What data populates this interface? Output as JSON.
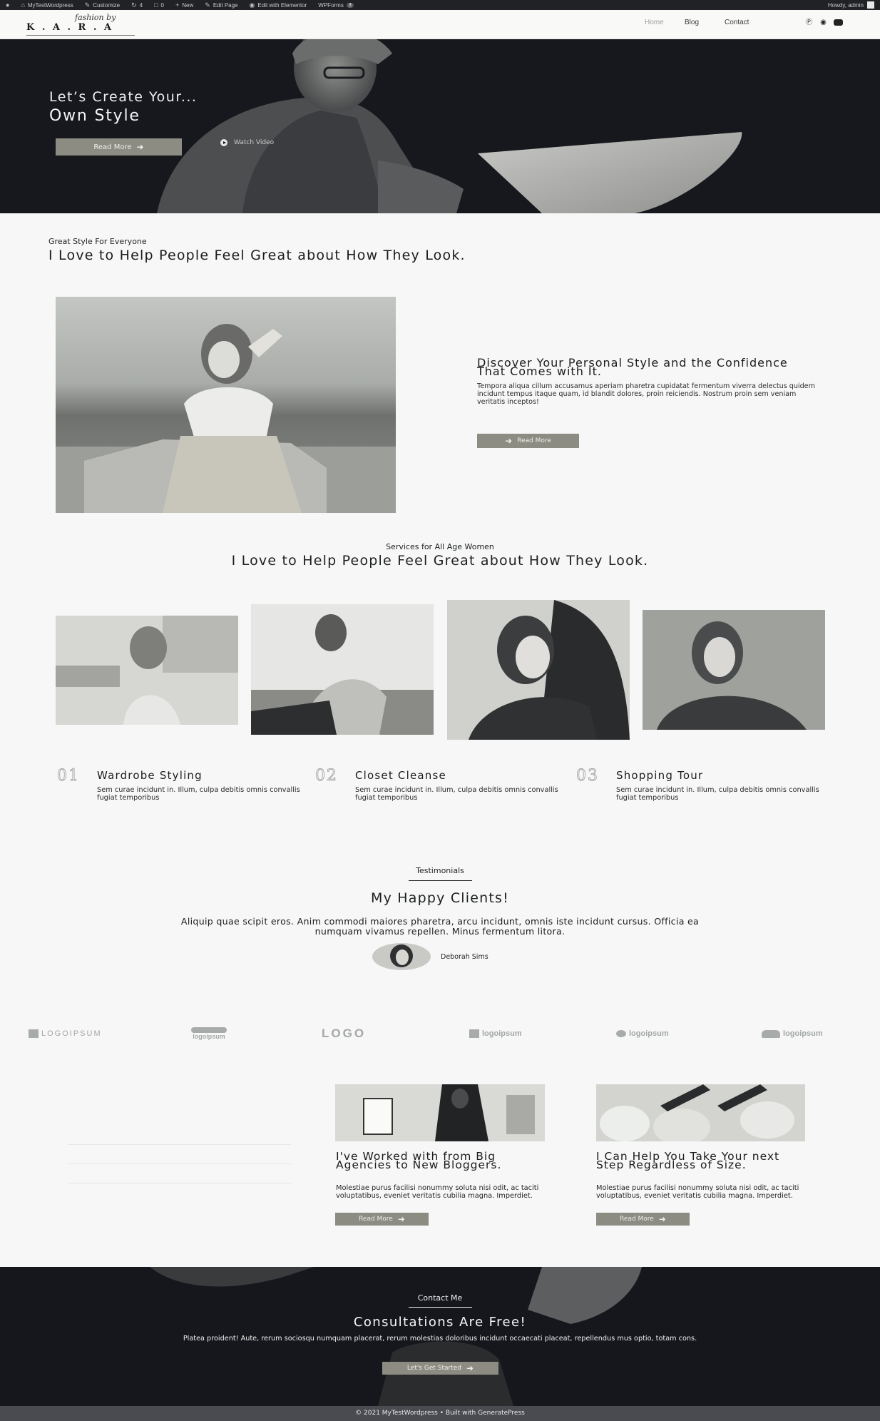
{
  "admin_bar": {
    "site_name": "MyTestWordpress",
    "customize": "Customize",
    "updates_count": "4",
    "comments_count": "0",
    "new": "New",
    "edit_page": "Edit Page",
    "edit_elementor": "Edit with Elementor",
    "wpforms": "WPForms",
    "wpforms_count": "3",
    "howdy": "Howdy, admin"
  },
  "header": {
    "logo_tagline": "fashion by",
    "logo_name": "K . A . R . A",
    "nav": [
      "Home",
      "Blog",
      "Contact"
    ],
    "social_icons": [
      "pinterest-icon",
      "instagram-icon",
      "youtube-icon"
    ]
  },
  "hero": {
    "subtitle": "Let’s Create Your...",
    "title": "Own Style",
    "read_more": "Read More",
    "watch_video": "Watch Video"
  },
  "about": {
    "eyebrow": "Great Style For Everyone",
    "title": "I Love to Help People Feel Great about How They Look.",
    "heading": "Discover Your Personal Style and the Confidence That Comes with It.",
    "text": "Tempora aliqua cillum accusamus aperiam pharetra cupidatat fermentum viverra delectus quidem incidunt tempus itaque quam, id blandit dolores, proin reiciendis. Nostrum proin sem veniam veritatis inceptos!",
    "button": "Read More"
  },
  "services": {
    "eyebrow": "Services for All Age Women",
    "title": "I Love to Help People Feel Great about How They Look.",
    "items": [
      {
        "num": "01",
        "name": "Wardrobe Styling",
        "desc": "Sem curae incidunt in. Illum, culpa debitis omnis convallis fugiat temporibus"
      },
      {
        "num": "02",
        "name": "Closet Cleanse",
        "desc": "Sem curae incidunt in. Illum, culpa debitis omnis convallis fugiat temporibus"
      },
      {
        "num": "03",
        "name": "Shopping Tour",
        "desc": "Sem curae incidunt in. Illum, culpa debitis omnis convallis fugiat temporibus"
      }
    ]
  },
  "testimonials": {
    "eyebrow": "Testimonials",
    "title": "My Happy Clients!",
    "quote": "Aliquip quae scipit eros. Anim commodi maiores pharetra, arcu incidunt, omnis iste incidunt cursus. Officia ea numquam vivamus repellen. Minus fermentum litora.",
    "name": "Deborah Sims"
  },
  "logos": [
    {
      "text": "LOGOIPSUM"
    },
    {
      "text": "logoipsum"
    },
    {
      "text": "LOGO"
    },
    {
      "text": "logoipsum"
    },
    {
      "text": "logoipsum"
    },
    {
      "text": "logoipsum"
    }
  ],
  "posts": [
    {
      "title": "I've Worked with from Big Agencies to New Bloggers.",
      "text": "Molestiae purus facilisi nonummy soluta nisi odit, ac taciti voluptatibus, eveniet veritatis cubilia magna. Imperdiet.",
      "button": "Read More"
    },
    {
      "title": "I Can Help You Take Your next Step Regardless of Size.",
      "text": "Molestiae purus facilisi nonummy soluta nisi odit, ac taciti voluptatibus, eveniet veritatis cubilia magna. Imperdiet.",
      "button": "Read More"
    }
  ],
  "contact": {
    "eyebrow": "Contact Me",
    "title": "Consultations Are Free!",
    "text": "Platea proident! Aute, rerum sociosqu numquam placerat, rerum molestias doloribus incidunt occaecati placeat, repellendus mus optio, totam cons.",
    "button": "Let's Get Started"
  },
  "footer": {
    "text": "© 2021 MyTestWordpress • Built with GeneratePress"
  },
  "colors": {
    "accent": "#8c8c82",
    "dark_section": "#17181d",
    "page_bg": "#f6f7f6",
    "footer_bg": "#4a4b50"
  }
}
